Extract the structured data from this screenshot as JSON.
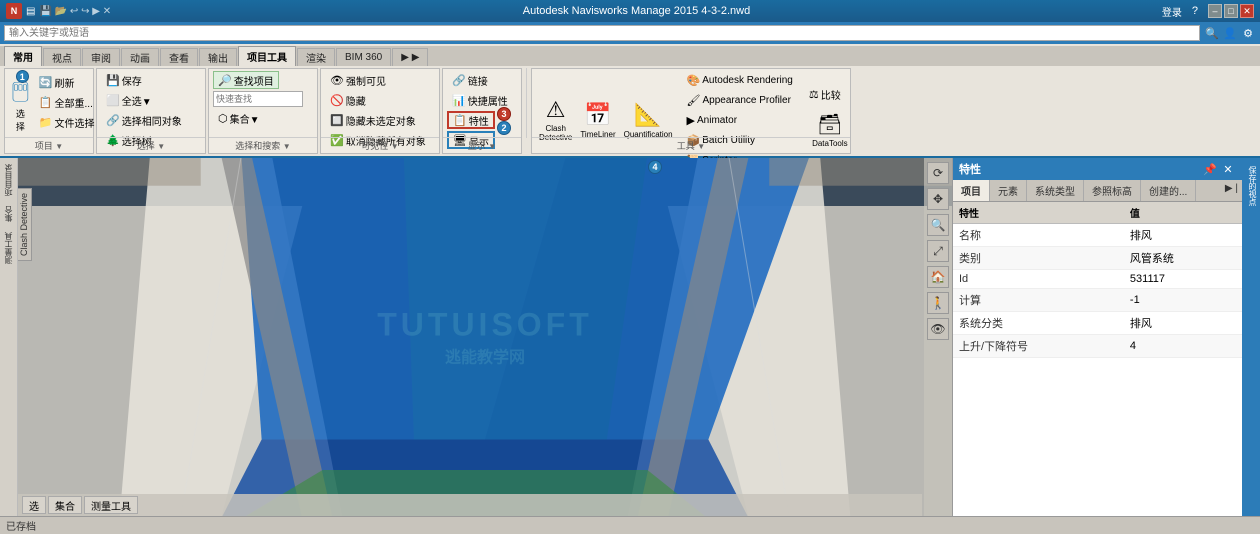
{
  "app": {
    "title": "Autodesk Navisworks Manage 2015  4-3-2.nwd",
    "nav_icon": "N",
    "search_placeholder": "输入关键字或短语"
  },
  "titlebar": {
    "buttons": {
      "min": "–",
      "max": "□",
      "close": "✕",
      "help_icon": "?",
      "login": "登录"
    }
  },
  "ribbon": {
    "tabs": [
      {
        "label": "常用",
        "active": true
      },
      {
        "label": "视点"
      },
      {
        "label": "审阅"
      },
      {
        "label": "动画"
      },
      {
        "label": "查看"
      },
      {
        "label": "输出"
      },
      {
        "label": "项目工具",
        "active_style": true
      },
      {
        "label": "渲染"
      },
      {
        "label": "BIM 360"
      },
      {
        "label": "▶ ▶"
      }
    ],
    "groups": {
      "project": {
        "label": "项目",
        "refresh_btn": "刷新",
        "reload_btn": "全部重...",
        "file_select_btn": "文件选择"
      },
      "select": {
        "label": "选择",
        "select_btn": "选择",
        "save_btn": "保存",
        "all_btn": "全选▼",
        "same_btn": "选择相同对象",
        "tree_btn": "选择树"
      },
      "search": {
        "label": "选择和搜索",
        "find_item_btn": "查找项目",
        "quick_search": "快速查找",
        "set_btn": "集合▼"
      },
      "visibility": {
        "label": "可见性",
        "force_visible_btn": "强制可见",
        "hide_btn": "隐藏",
        "hide_unselected_btn": "隐藏未选定对象",
        "unhide_all_btn": "取消隐藏所有对象"
      },
      "display": {
        "label": "显示",
        "link_btn": "链接",
        "quick_prop_btn": "快捷属性",
        "clash_btn": "特性",
        "display_btn": "显示"
      },
      "clash": {
        "label": "工具",
        "clash_detective": "Clash\nDetective",
        "timeliner": "TimeLiner",
        "quantification": "Quantification",
        "animator": "Animator",
        "scripter": "Scripter",
        "autodesk_rendering": "Autodesk Rendering",
        "appearance_profiler": "Appearance Profiler",
        "batch_utility": "Batch Utility",
        "compare_btn": "比较",
        "data_tools": "DataTools"
      }
    }
  },
  "viewport": {
    "watermark_line1": "TUTUISOFT",
    "watermark_line2": "逃能教学网",
    "clash_label": "Clash Detective",
    "bottom_btns": [
      "选",
      "集合",
      "测量工具"
    ]
  },
  "left_sidebar": {
    "items": [
      "项目目录",
      "集合",
      "测量工具"
    ]
  },
  "right_panel": {
    "title": "特性",
    "tabs": [
      "项目",
      "元素",
      "系统类型",
      "参照标高",
      "创建的..."
    ],
    "more_tab": "▶ |",
    "properties": [
      {
        "name": "特性",
        "value": "值"
      },
      {
        "name": "名称",
        "value": "排风"
      },
      {
        "name": "类别",
        "value": "风管系统"
      },
      {
        "name": "Id",
        "value": "531117"
      },
      {
        "name": "计算",
        "value": "-1"
      },
      {
        "name": "系统分类",
        "value": "排风"
      },
      {
        "name": "上升/下降符号",
        "value": "4"
      }
    ]
  },
  "statusbar": {
    "already_stored": "已存档"
  },
  "annotations": [
    {
      "id": "1",
      "type": "blue"
    },
    {
      "id": "2",
      "type": "blue"
    },
    {
      "id": "3",
      "type": "red"
    },
    {
      "id": "4",
      "type": "blue"
    }
  ]
}
